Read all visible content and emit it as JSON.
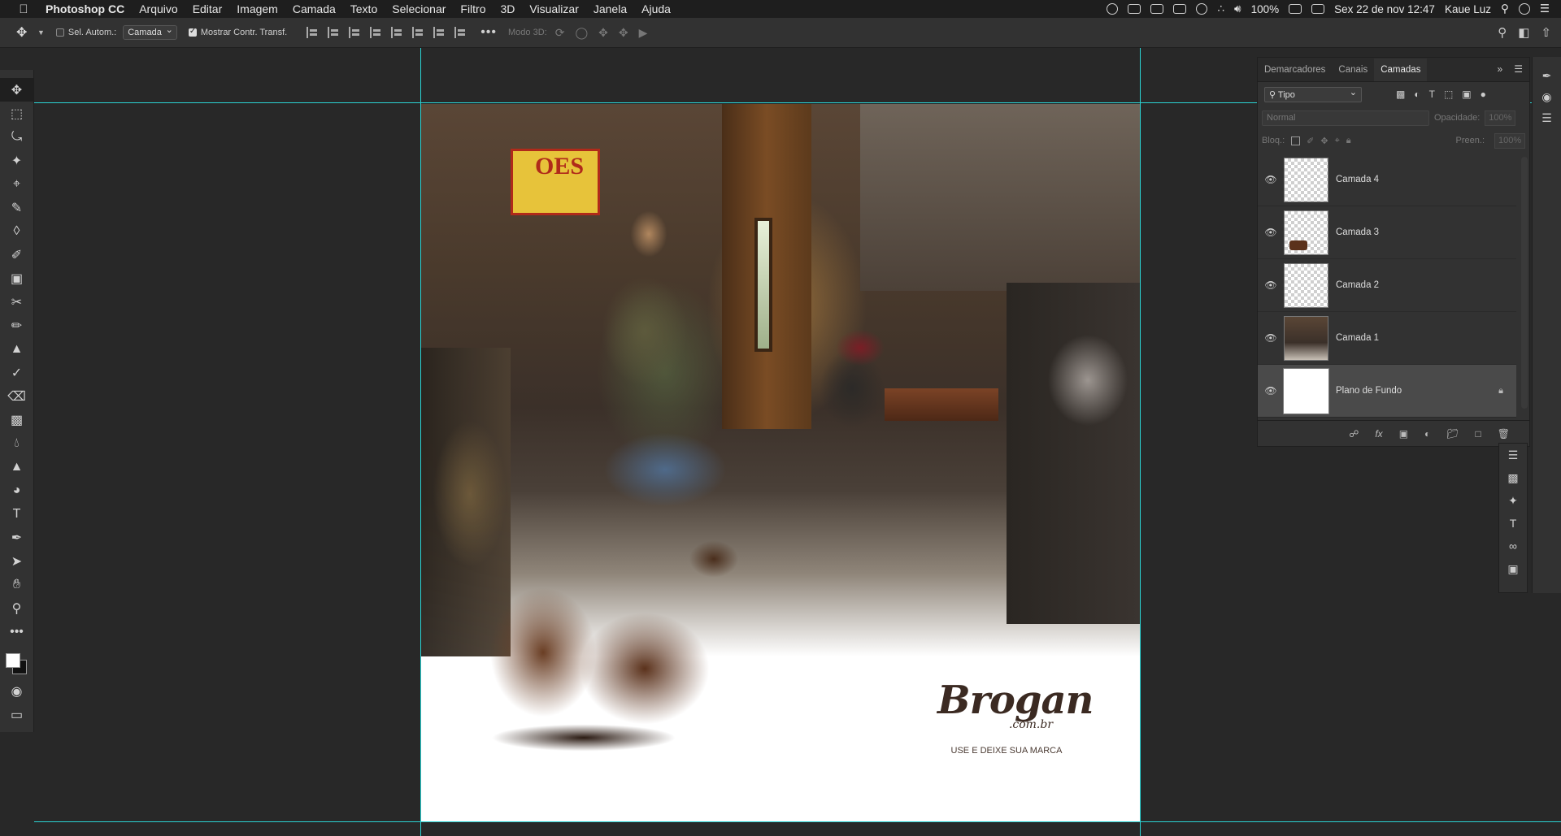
{
  "menubar": {
    "app_name": "Photoshop CC",
    "menus": [
      "Arquivo",
      "Editar",
      "Imagem",
      "Camada",
      "Texto",
      "Selecionar",
      "Filtro",
      "3D",
      "Visualizar",
      "Janela",
      "Ajuda"
    ],
    "battery": "100%",
    "datetime": "Sex 22 de nov  12:47",
    "user": "Kaue Luz"
  },
  "options": {
    "auto_select_label": "Sel. Autom.:",
    "auto_select_target": "Camada",
    "show_transform_label": "Mostrar Contr. Transf.",
    "mode_3d_label": "Modo 3D:"
  },
  "canvas": {
    "sign_text": "OES",
    "brand": "Brogan",
    "domain": ".com.br",
    "tagline": "USE E DEIXE SUA MARCA"
  },
  "layers_panel": {
    "tabs": [
      "Demarcadores",
      "Canais",
      "Camadas"
    ],
    "active_tab": "Camadas",
    "filter": "Tipo",
    "blend_mode": "Normal",
    "opacity_label": "Opacidade:",
    "opacity_value": "100%",
    "lock_label": "Bloq.:",
    "fill_label": "Preen.:",
    "fill_value": "100%",
    "layers": [
      {
        "name": "Camada 4",
        "thumb": "transparent"
      },
      {
        "name": "Camada 3",
        "thumb": "boot"
      },
      {
        "name": "Camada 2",
        "thumb": "transparent"
      },
      {
        "name": "Camada 1",
        "thumb": "photo"
      },
      {
        "name": "Plano de Fundo",
        "thumb": "white",
        "locked": true,
        "selected": true
      }
    ]
  },
  "colors": {
    "guide": "#2bd4d4",
    "ui_bg": "#282828",
    "panel_bg": "#323232"
  }
}
